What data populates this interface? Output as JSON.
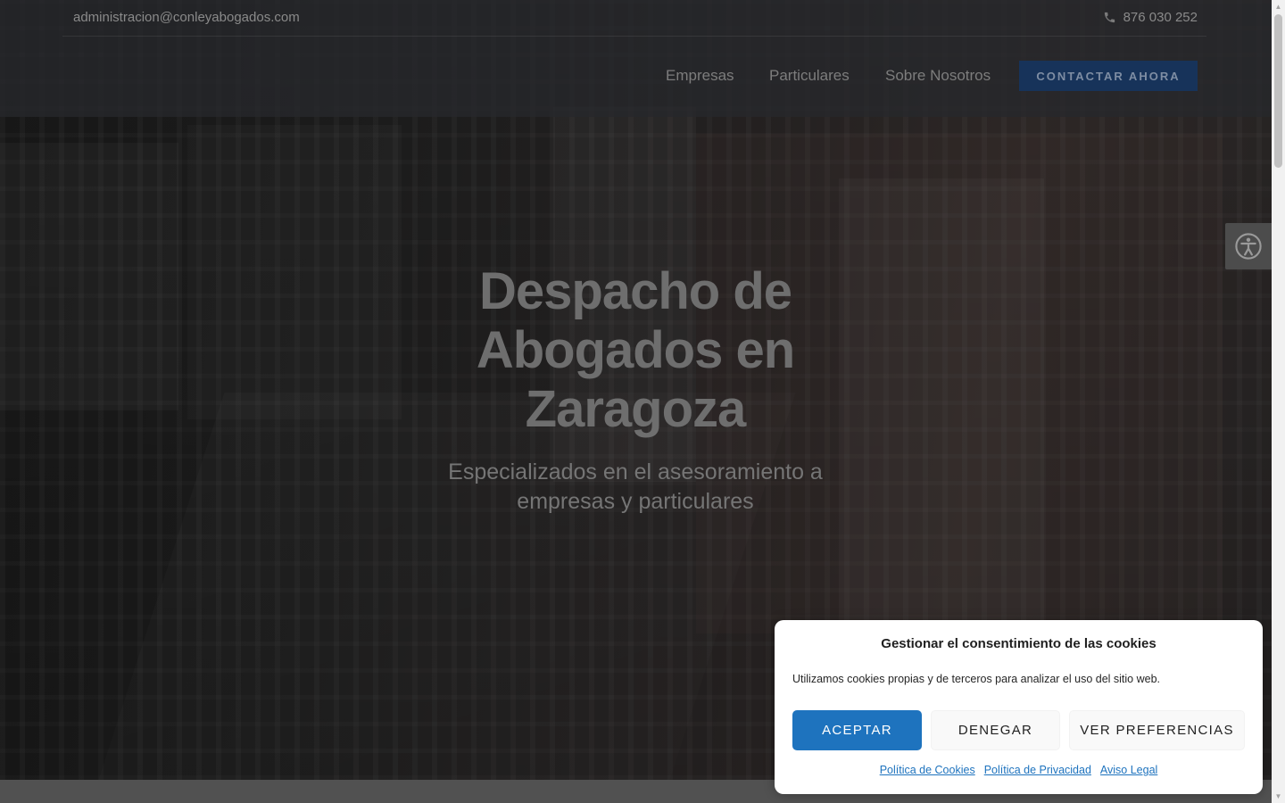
{
  "topbar": {
    "email": "administracion@conleyabogados.com",
    "phone": "876 030 252"
  },
  "nav": {
    "items": [
      "Empresas",
      "Particulares",
      "Sobre Nosotros"
    ],
    "cta_label": "CONTACTAR AHORA"
  },
  "hero": {
    "title": "Despacho de Abogados en Zaragoza",
    "subtitle": "Especializados en el asesoramiento a empresas y particulares"
  },
  "accessibility": {
    "icon": "accessibility-icon"
  },
  "cookie_banner": {
    "title": "Gestionar el consentimiento de las cookies",
    "text": "Utilizamos cookies propias y de terceros para analizar el uso del sitio web.",
    "accept_label": "ACEPTAR",
    "deny_label": "DENEGAR",
    "prefs_label": "VER PREFERENCIAS",
    "links": [
      "Política de Cookies",
      "Política de Privacidad",
      "Aviso Legal"
    ],
    "accent_color": "#1e73be"
  }
}
